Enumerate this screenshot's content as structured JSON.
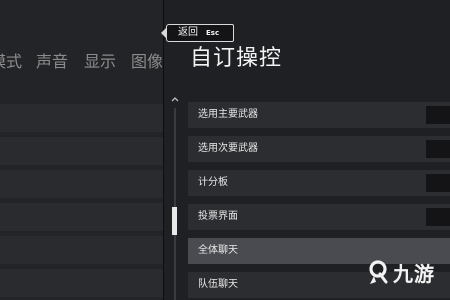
{
  "left_panel": {
    "tabs": [
      "模式",
      "声音",
      "显示",
      "图像"
    ]
  },
  "header": {
    "back_label": "返回",
    "back_key": "Esc",
    "title": "自订操控"
  },
  "controls": [
    {
      "label": "选用主要武器"
    },
    {
      "label": "选用次要武器"
    },
    {
      "label": "计分板"
    },
    {
      "label": "投票界面"
    },
    {
      "label": "全体聊天",
      "selected": true
    },
    {
      "label": "队伍聊天"
    }
  ],
  "watermark": {
    "text": "九游"
  }
}
